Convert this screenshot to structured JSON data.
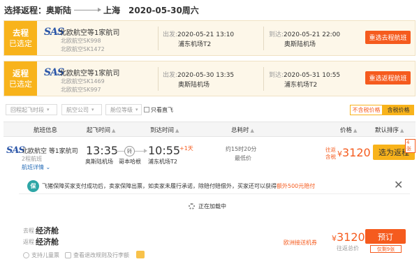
{
  "trip": {
    "prefix": "选择返程：",
    "from": "奥斯陆",
    "to": "上海",
    "date": "2020-05-30周六"
  },
  "segments": [
    {
      "badge_big": "去程",
      "badge_small": "已选定",
      "airline": "北欧航空等1家航司",
      "flight1": "北欧航空SK998",
      "flight2": "北欧航空SK1472",
      "dep_label": "出发:",
      "dep_time": "2020-05-21 13:10",
      "dep_airport": "浦东机场T2",
      "arr_label": "到达:",
      "arr_time": "2020-05-21 22:00",
      "arr_airport": "奥斯陆机场",
      "button": "重选去程航班"
    },
    {
      "badge_big": "返程",
      "badge_small": "已选定",
      "airline": "北欧航空等1家航司",
      "flight1": "北欧航空SK1469",
      "flight2": "北欧航空SK997",
      "dep_label": "出发:",
      "dep_time": "2020-05-30 13:35",
      "dep_airport": "奥斯陆机场",
      "arr_label": "到达:",
      "arr_time": "2020-05-31 10:55",
      "arr_airport": "浦东机场T2",
      "button": "重选返程航班"
    }
  ],
  "filters": {
    "time": "回程起飞时段",
    "airline": "航空公司",
    "cabin": "舱位等级",
    "direct": "只看直飞",
    "toggle_excl": "不含税价格",
    "toggle_incl": "含税价格"
  },
  "columns": {
    "info": "航班信息",
    "dep": "起飞时间",
    "arr": "到达时间",
    "total": "总耗时",
    "price": "价格",
    "sort": "默认排序"
  },
  "flight": {
    "airline": "北欧航空 等1家航司",
    "legs": "2程航班",
    "detail": "航班详情",
    "dep_time": "13:35",
    "dep_airport": "奥斯陆机场",
    "transfer": "转",
    "transfer_city": "哥本哈根",
    "arr_time": "10:55",
    "plus_day": "+1天",
    "arr_airport": "浦东机场T2",
    "duration": "约15时20分",
    "duration_note": "最低价",
    "price_lbl1": "往返",
    "price_lbl2": "含税",
    "currency": "¥",
    "price": "3120",
    "select": "选为返程",
    "badge": "4张"
  },
  "notice": {
    "icon": "保",
    "text": "飞猪保障买家支付成功后，卖家保障出票，如卖家未履行承诺，除赔付赔偿外，买家还可以获得",
    "highlight": "额外500元赔付"
  },
  "loading": "正在加载中",
  "cabin": {
    "go_label": "去程",
    "go_value": "经济舱",
    "ret_label": "返程",
    "ret_value": "经济舱",
    "child": "支持儿童票",
    "rules": "查看退改规则及行李额",
    "promo": "欧洲接送机券",
    "currency": "¥",
    "price": "3120",
    "price_sub": "往返总价",
    "book": "预订",
    "book_tag": "仅剩9张"
  },
  "colors": {
    "accent_orange": "#f55b1e",
    "badge_yellow": "#f8b31b",
    "segment_bg": "#fdf7e9",
    "link_blue": "#2a6fb8"
  }
}
